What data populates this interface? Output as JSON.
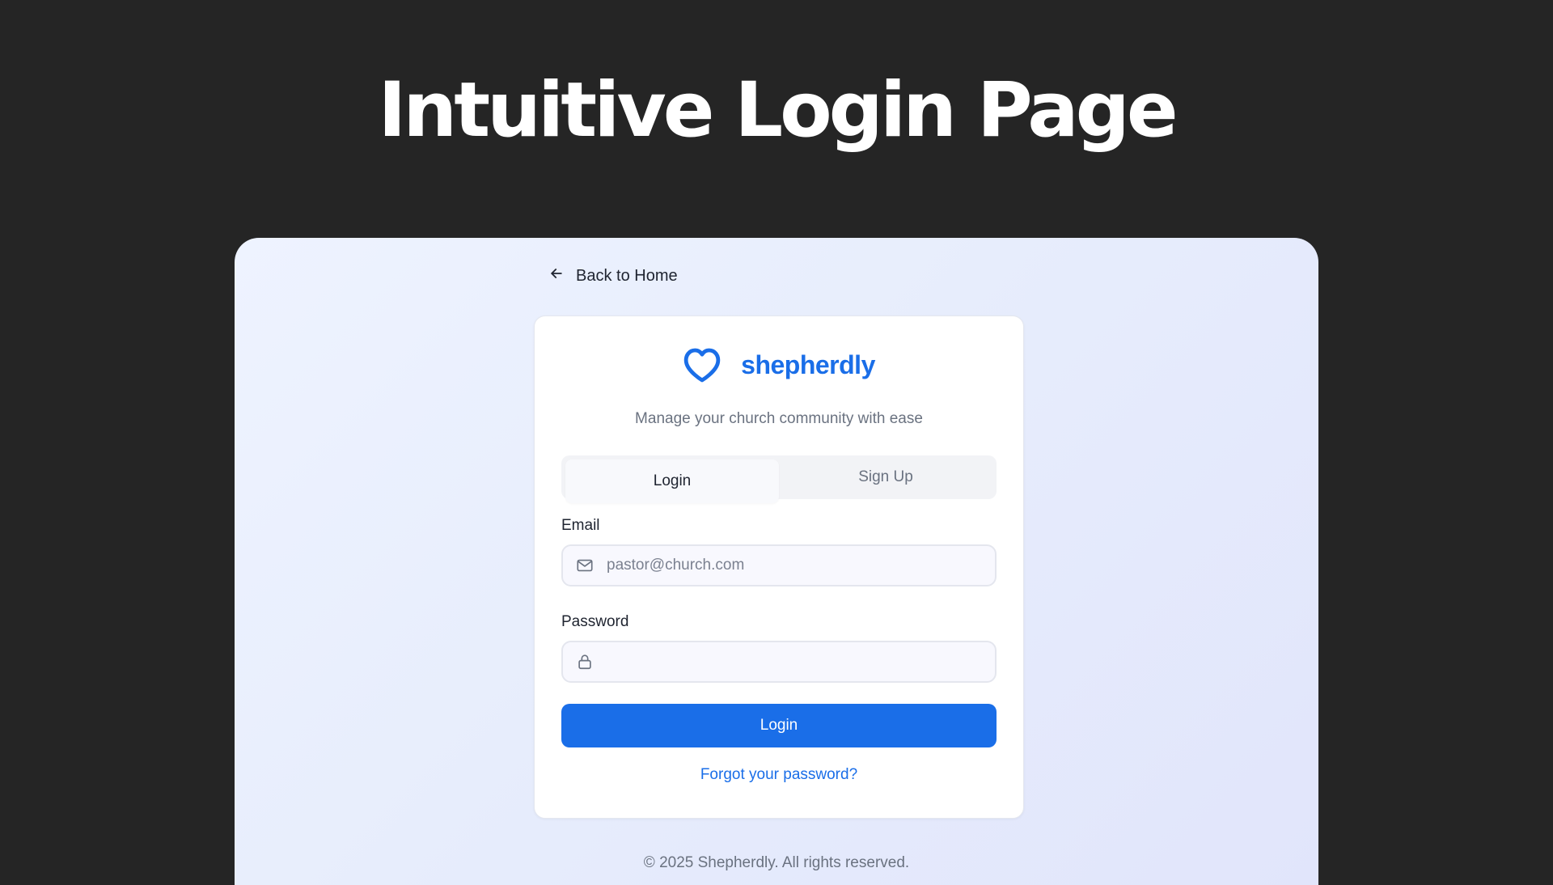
{
  "hero": {
    "title": "Intuitive Login Page"
  },
  "nav": {
    "back_label": "Back to Home"
  },
  "brand": {
    "name": "shepherdly",
    "tagline": "Manage your church community with ease",
    "color": "#1a6ee8"
  },
  "tabs": [
    {
      "label": "Login",
      "active": true
    },
    {
      "label": "Sign Up",
      "active": false
    }
  ],
  "form": {
    "email": {
      "label": "Email",
      "placeholder": "pastor@church.com",
      "value": ""
    },
    "password": {
      "label": "Password",
      "placeholder": "",
      "value": ""
    },
    "submit_label": "Login",
    "forgot_label": "Forgot your password?"
  },
  "footer": {
    "text": "© 2025 Shepherdly. All rights reserved."
  },
  "icons": {
    "back": "arrow-left-icon",
    "brand": "heart-icon",
    "email": "mail-icon",
    "password": "lock-icon"
  }
}
